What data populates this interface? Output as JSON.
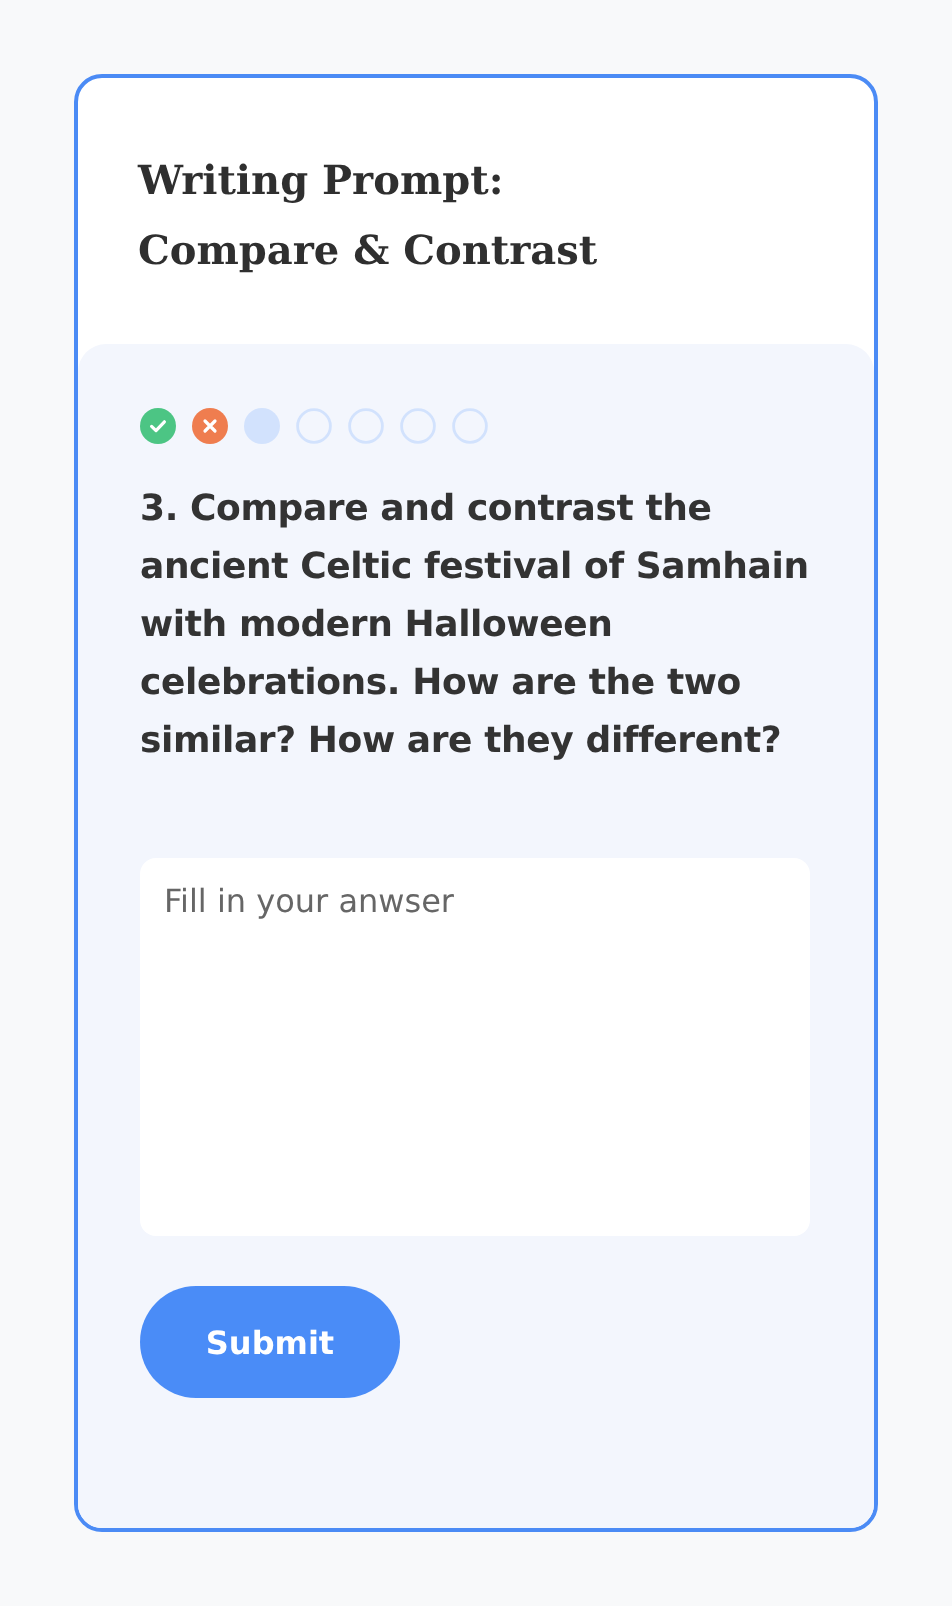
{
  "title_lines": [
    "Writing Prompt:",
    "Compare & Contrast"
  ],
  "progress": [
    {
      "kind": "correct"
    },
    {
      "kind": "wrong"
    },
    {
      "kind": "current"
    },
    {
      "kind": "pending"
    },
    {
      "kind": "pending"
    },
    {
      "kind": "pending"
    },
    {
      "kind": "pending"
    }
  ],
  "question": "3. Compare and contrast the ancient Celtic festival of Samhain with modern Halloween celebrations. How are the two similar? How are they different?",
  "answer": {
    "placeholder": "Fill in your anwser"
  },
  "submit_button": "Submit"
}
